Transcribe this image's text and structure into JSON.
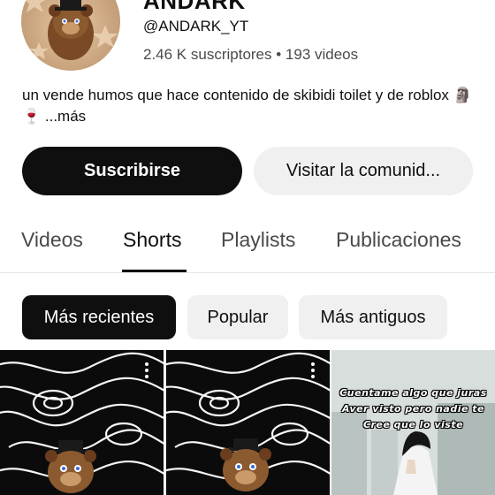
{
  "channel": {
    "title": "ANDARK",
    "handle": "@ANDARK_YT",
    "stats": "2.46 K suscriptores • 193 videos",
    "description": "un vende humos que hace contenido de skibidi toilet y de roblox 🗿 🍷 ",
    "more_label": "...más"
  },
  "actions": {
    "subscribe_label": "Suscribirse",
    "community_label": "Visitar la comunid..."
  },
  "tabs": [
    {
      "label": "Videos"
    },
    {
      "label": "Shorts",
      "active": true
    },
    {
      "label": "Playlists"
    },
    {
      "label": "Publicaciones"
    }
  ],
  "filters": [
    {
      "label": "Más recientes",
      "selected": true
    },
    {
      "label": "Popular"
    },
    {
      "label": "Más antiguos"
    }
  ],
  "shorts": [
    {
      "thumbnail": "freddy-topographic-dark",
      "overlay": []
    },
    {
      "thumbnail": "freddy-topographic-dark",
      "overlay": []
    },
    {
      "thumbnail": "anime-character-city",
      "overlay": [
        "Cuentame algo que juras",
        "Aver visto pero nadie te",
        "Cree que lo viste"
      ]
    }
  ],
  "colors": {
    "primary_button": "#0f0f0f",
    "secondary_button": "#f0f0f0",
    "muted_text": "#4a4a4a"
  }
}
